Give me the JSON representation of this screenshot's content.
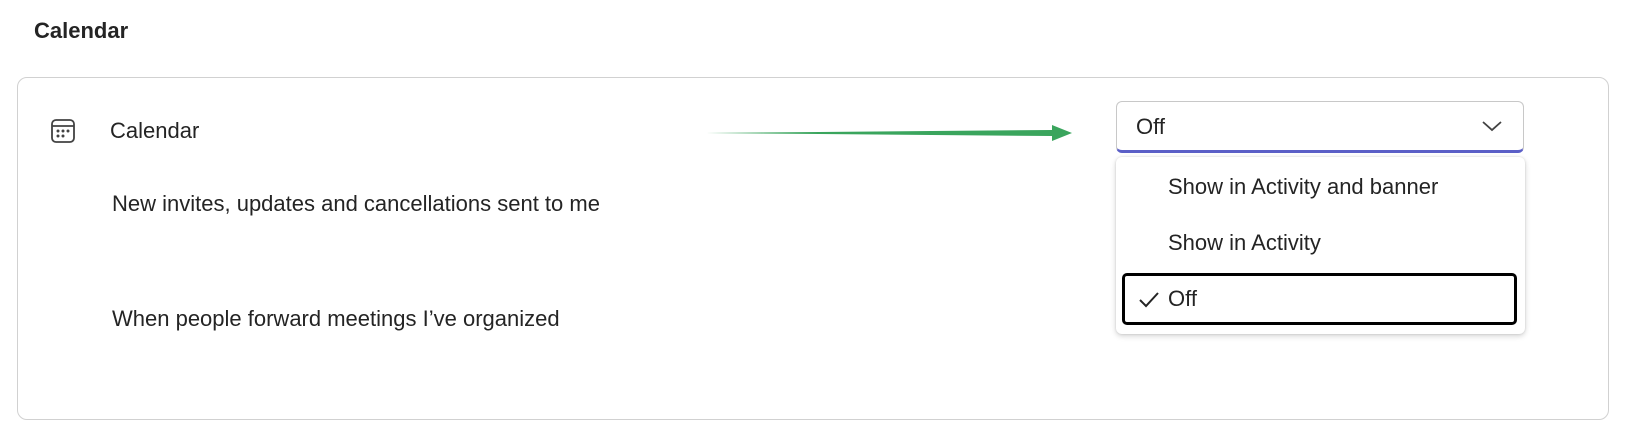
{
  "section": {
    "title": "Calendar"
  },
  "card": {
    "icon": "calendar-icon",
    "title": "Calendar",
    "rows": [
      {
        "label": "New invites, updates and cancellations sent to me"
      },
      {
        "label": "When people forward meetings I’ve organized"
      }
    ]
  },
  "dropdown": {
    "selected_value": "Off",
    "options": [
      {
        "label": "Show in Activity and banner",
        "selected": false
      },
      {
        "label": "Show in Activity",
        "selected": false
      },
      {
        "label": "Off",
        "selected": true
      }
    ]
  },
  "annotation": {
    "type": "arrow",
    "color": "#3aa55d"
  },
  "colors": {
    "accent_underline": "#5b5fc7",
    "focus_border": "#000000",
    "text": "#242424",
    "card_border": "#d1d1d1"
  }
}
